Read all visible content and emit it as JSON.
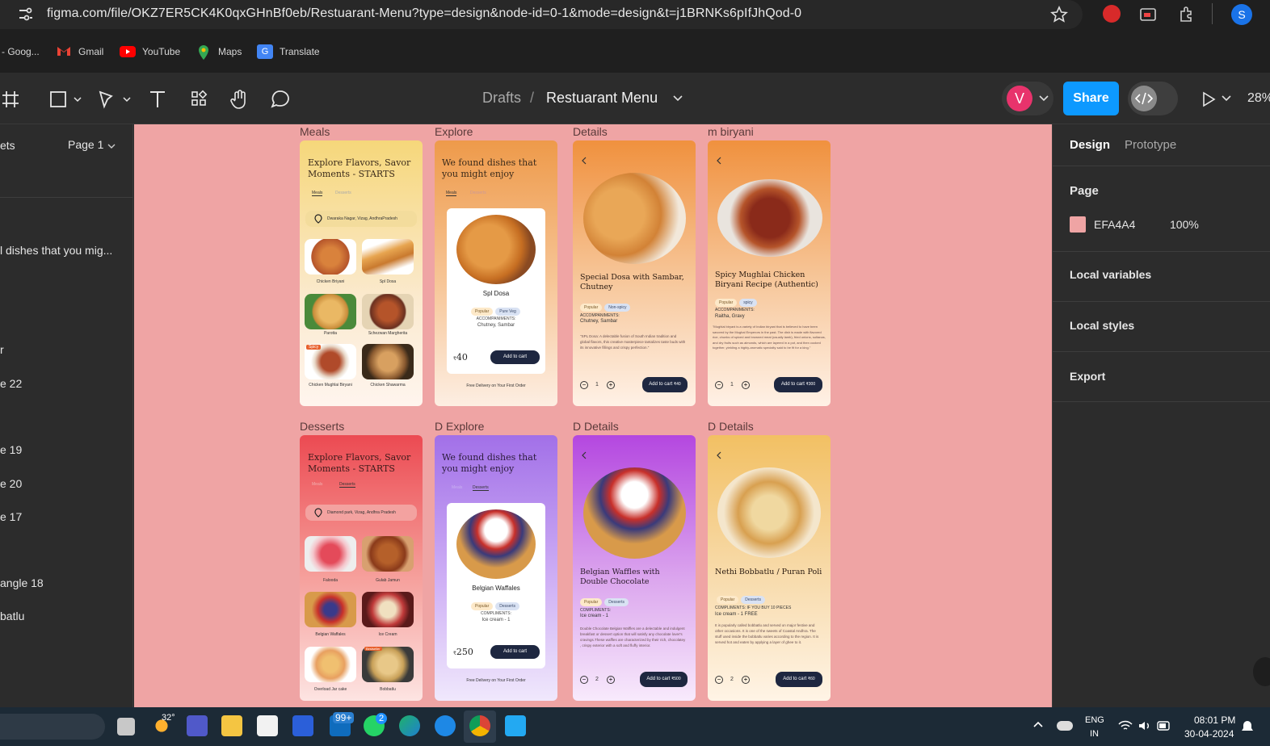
{
  "browser": {
    "url": "figma.com/file/OKZ7ER5CK4K0qxGHnBf0eb/Restuarant-Menu?type=design&node-id=0-1&mode=design&t=j1BRNKs6pIfJhQod-0",
    "profile_initial": "S",
    "bookmarks": [
      "- Goog...",
      "Gmail",
      "YouTube",
      "Maps",
      "Translate"
    ]
  },
  "figma": {
    "breadcrumb_root": "Drafts",
    "breadcrumb_sep": "/",
    "file_name": "Restuarant Menu",
    "avatar_initial": "V",
    "share_label": "Share",
    "zoom": "28%",
    "page_tab": "Page 1",
    "left_tab_fragment": "ets",
    "layers": [
      "l dishes that you mig...",
      "r",
      "e 22",
      "e 19",
      "e 20",
      "e 17",
      "angle 18",
      "batlu"
    ]
  },
  "right_panel": {
    "tabs": [
      "Design",
      "Prototype"
    ],
    "page_heading": "Page",
    "page_color_hex": "EFA4A4",
    "page_opacity": "100%",
    "sections": [
      "Local variables",
      "Local styles",
      "Export"
    ]
  },
  "colors": {
    "canvas": "#EFA4A4",
    "share": "#0d99ff",
    "avatar": "#e8336c"
  },
  "frames": {
    "labels": [
      "Meals",
      "Explore",
      "Details",
      "m biryani",
      "Desserts",
      "D Explore",
      "D Details",
      "D Details"
    ],
    "meals": {
      "title": "Explore Flavors, Savor Moments - STARTS",
      "tabs": [
        "Meals",
        "Desserts"
      ],
      "location": "Dwaraka Nagar, Vizag, AndhraPradesh",
      "items": [
        "Chicken Briyani",
        "Spl Dosa",
        "Parotta",
        "Schezwan Margherita",
        "Chicken Mughlai Biryani",
        "Chicken Shawarma"
      ],
      "spicy_tag": "Spicy"
    },
    "explore": {
      "title": "We found dishes that you might enjoy",
      "tabs": [
        "Meals",
        "Desserts"
      ],
      "dish": "Spl Dosa",
      "chips": [
        "Popular",
        "Pure Veg"
      ],
      "acc_label": "ACCOMPANIMENTS:",
      "acc_value": "Chutney, Sambar",
      "price": "40",
      "cart": "Add to cart",
      "footer": "Free Delivery on Your First Order"
    },
    "details": {
      "title": "Special Dosa with Sambar, Chutney",
      "chips": [
        "Popular",
        "Non-spicy"
      ],
      "acc_label": "ACCOMPANIMENTS:",
      "acc_value": "Chutney, Sambar",
      "desc": "\"SPL Dosa: A delectable fusion of South Indian tradition and global flavors, this creative masterpiece tantalizes taste buds with its innovative fillings and crispy perfection.\"",
      "qty": "1",
      "cart": "Add to cart",
      "price": "₹40"
    },
    "biryani": {
      "title": "Spicy Mughlai Chicken Biryani Recipe (Authentic)",
      "chips": [
        "Popular",
        "spicy"
      ],
      "acc_label": "ACCOMPANIMENTS:",
      "acc_value": "Raitha, Gravy",
      "desc": "\"Mughlai biryani is a variety of Indian biryani that is believed to have been savored by the Mughal Emperors in the past. The dish is made with flavored rice, chunks of spiced and browned meat (usually lamb), fried onions, sultanas, and dry fruits such as almonds, which are layered in a pot, and then cooked together, yielding a highly-aromatic specialty said to be fit for a king.\"",
      "qty": "1",
      "cart": "Add to cart",
      "price": "₹300"
    },
    "desserts": {
      "title": "Explore Flavors, Savor Moments - STARTS",
      "tabs": [
        "Meals",
        "Desserts"
      ],
      "location": "Diamond park, Vizag, Andhra Pradesh",
      "items": [
        "Falooda",
        "Gulab Jamun",
        "Belgian Waffales",
        "Ice Cream",
        "Overload Jar cake",
        "Bobbatlu"
      ],
      "best_tag": "Bestseller"
    },
    "d_explore": {
      "title": "We found dishes that you might enjoy",
      "tabs": [
        "Meals",
        "Desserts"
      ],
      "dish": "Belgian Waffales",
      "chips": [
        "Popular",
        "Desserts"
      ],
      "acc_label": "COMPLIMENTS:",
      "acc_value": "Ice cream - 1",
      "price": "250",
      "cart": "Add to cart",
      "footer": "Free Delivery on Your First Order"
    },
    "d_details": {
      "title": "Belgian Waffles with Double Chocolate",
      "chips": [
        "Popular",
        "Desserts"
      ],
      "acc_label": "COMPLIMENTS:",
      "acc_value": "Ice cream - 1",
      "desc": "Double Chocolate Belgian Waffles are a delectable and indulgent breakfast or dessert option that will satisfy any chocolate lover's cravings.These waffles are characterized by their rich, chocolatey , crispy exterior with a soft and fluffy interior.",
      "qty": "2",
      "cart": "Add to cart",
      "price": "₹500"
    },
    "d_details2": {
      "title": "Nethi Bobbatlu / Puran Poli",
      "chips": [
        "Popular",
        "Desserts"
      ],
      "acc_label": "COMPLIMENTS: IF YOU BUY 10 PIECES",
      "acc_value": "Ice cream - 1 FREE",
      "desc": "It is popularly called bobbatlu and served on major festive and other occasions. It is one of the sweets of Coastal Andhra. The stuff used inside the bobbatlu varies according to the region. It is served hot and eaten by applying a layer of ghee to it.",
      "qty": "2",
      "cart": "Add to cart",
      "price": "₹60"
    }
  },
  "taskbar": {
    "temperature": "32°",
    "mail_badge": "99+",
    "whatsapp_badge": "2",
    "lang_top": "ENG",
    "lang_bottom": "IN",
    "time": "08:01 PM",
    "date": "30-04-2024"
  }
}
